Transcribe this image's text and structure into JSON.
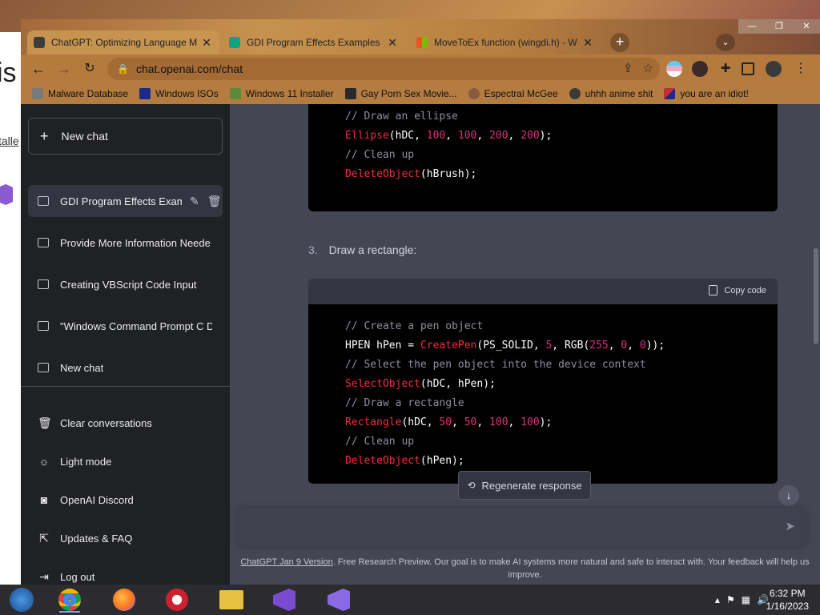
{
  "desktop": {
    "left_fragment_1": "is",
    "left_fragment_2": "talle"
  },
  "tabs": [
    {
      "title": "ChatGPT: Optimizing Language M",
      "active": true,
      "favicon_color": "#3d3d3d"
    },
    {
      "title": "GDI Program Effects Examples",
      "active": false,
      "favicon_color": "#10a37f"
    },
    {
      "title": "MoveToEx function (wingdi.h) - W",
      "active": false,
      "favicon_color": "#f25022"
    }
  ],
  "tab_close_glyph": "✕",
  "window_controls": [
    "—",
    "❐",
    "✕"
  ],
  "address": {
    "url": "chat.openai.com/chat"
  },
  "bookmarks": [
    {
      "label": "Malware Database",
      "icon_color": "#7a7a7a"
    },
    {
      "label": "Windows ISOs",
      "icon_color": "#1a2a8a"
    },
    {
      "label": "Windows 11 Installer",
      "icon_color": "#5a8a3a"
    },
    {
      "label": "Gay Porn Sex Movie...",
      "icon_color": "#2a2a2a"
    },
    {
      "label": "Espectral McGee",
      "icon_color": "#8a5a3a"
    },
    {
      "label": "uhhh anime shit",
      "icon_color": "#3a3a3a"
    },
    {
      "label": "you are an idiot!",
      "icon_color": "#c03030"
    }
  ],
  "sidebar": {
    "new_chat": "New chat",
    "conversations": [
      {
        "title": "GDI Program Effects Exam",
        "active": true
      },
      {
        "title": "Provide More Information Neede",
        "active": false
      },
      {
        "title": "Creating VBScript Code Input",
        "active": false
      },
      {
        "title": "\"Windows Command Prompt C D",
        "active": false
      },
      {
        "title": "New chat",
        "active": false
      }
    ],
    "bottom": [
      {
        "label": "Clear conversations",
        "icon": "trash-icon",
        "glyph": "🗑"
      },
      {
        "label": "Light mode",
        "icon": "sun-icon",
        "glyph": "☼"
      },
      {
        "label": "OpenAI Discord",
        "icon": "discord-icon",
        "glyph": "◙"
      },
      {
        "label": "Updates & FAQ",
        "icon": "external-link-icon",
        "glyph": "⇱"
      },
      {
        "label": "Log out",
        "icon": "logout-icon",
        "glyph": "⇥"
      }
    ]
  },
  "main": {
    "code_block_1": [
      [
        [
          "c-com",
          "// Draw an ellipse"
        ]
      ],
      [
        [
          "c-fn",
          "Ellipse"
        ],
        [
          "c-w",
          "(hDC, "
        ],
        [
          "c-num",
          "100"
        ],
        [
          "c-w",
          ", "
        ],
        [
          "c-num",
          "100"
        ],
        [
          "c-w",
          ", "
        ],
        [
          "c-num",
          "200"
        ],
        [
          "c-w",
          ", "
        ],
        [
          "c-num",
          "200"
        ],
        [
          "c-w",
          ");"
        ]
      ],
      [
        [
          "c-com",
          "// Clean up"
        ]
      ],
      [
        [
          "c-fn",
          "DeleteObject"
        ],
        [
          "c-w",
          "(hBrush);"
        ]
      ]
    ],
    "step_number": "3.",
    "step_text": "Draw a rectangle:",
    "copy_label": "Copy code",
    "code_block_2": [
      [
        [
          "c-com",
          "// Create a pen object"
        ]
      ],
      [
        [
          "c-w",
          "HPEN hPen = "
        ],
        [
          "c-fn",
          "CreatePen"
        ],
        [
          "c-w",
          "(PS_SOLID, "
        ],
        [
          "c-num",
          "5"
        ],
        [
          "c-w",
          ", RGB("
        ],
        [
          "c-num",
          "255"
        ],
        [
          "c-w",
          ", "
        ],
        [
          "c-num",
          "0"
        ],
        [
          "c-w",
          ", "
        ],
        [
          "c-num",
          "0"
        ],
        [
          "c-w",
          "));"
        ]
      ],
      [
        [
          "c-com",
          "// Select the pen object into the device context"
        ]
      ],
      [
        [
          "c-fn",
          "SelectObject"
        ],
        [
          "c-w",
          "(hDC, hPen);"
        ]
      ],
      [
        [
          "c-com",
          "// Draw a rectangle"
        ]
      ],
      [
        [
          "c-fn",
          "Rectangle"
        ],
        [
          "c-w",
          "(hDC, "
        ],
        [
          "c-num",
          "50"
        ],
        [
          "c-w",
          ", "
        ],
        [
          "c-num",
          "50"
        ],
        [
          "c-w",
          ", "
        ],
        [
          "c-num",
          "100"
        ],
        [
          "c-w",
          ", "
        ],
        [
          "c-num",
          "100"
        ],
        [
          "c-w",
          ");"
        ]
      ],
      [
        [
          "c-com",
          "// Clean up"
        ]
      ],
      [
        [
          "c-fn",
          "DeleteObject"
        ],
        [
          "c-w",
          "(hPen);"
        ]
      ]
    ],
    "regenerate_label": "Regenerate response",
    "input_placeholder": "",
    "footer_link": "ChatGPT Jan 9 Version",
    "footer_text": ". Free Research Preview. Our goal is to make AI systems more natural and safe to interact with. Your feedback will help us improve."
  },
  "taskbar": {
    "apps": [
      {
        "name": "windows-7-start-icon",
        "color": "#2a6ad0"
      },
      {
        "name": "chrome-icon",
        "color": "#db4437",
        "active": true
      },
      {
        "name": "firefox-icon",
        "color": "#ff7a1a"
      },
      {
        "name": "opera-icon",
        "color": "#d02030"
      },
      {
        "name": "file-explorer-icon",
        "color": "#e8c040"
      },
      {
        "name": "visual-studio-icon",
        "color": "#7a4ad0"
      },
      {
        "name": "visual-studio-installer-icon",
        "color": "#8a6ae0"
      }
    ],
    "time": "6:32 PM",
    "date": "1/16/2023"
  },
  "colors": {
    "sidebar_bg": "#202123",
    "main_bg": "#444654",
    "code_bg": "#000000",
    "accent_tab": "#c6924f"
  }
}
